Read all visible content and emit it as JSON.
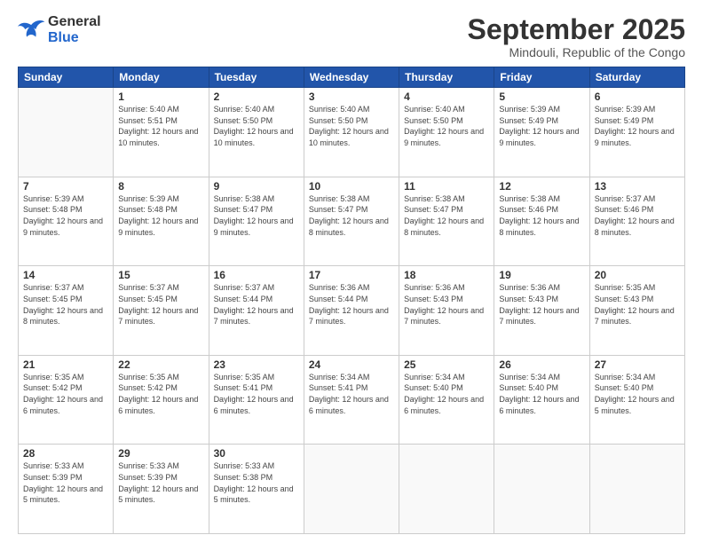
{
  "header": {
    "logo_general": "General",
    "logo_blue": "Blue",
    "month": "September 2025",
    "location": "Mindouli, Republic of the Congo"
  },
  "weekdays": [
    "Sunday",
    "Monday",
    "Tuesday",
    "Wednesday",
    "Thursday",
    "Friday",
    "Saturday"
  ],
  "weeks": [
    [
      {
        "day": "",
        "sunrise": "",
        "sunset": "",
        "daylight": ""
      },
      {
        "day": "1",
        "sunrise": "Sunrise: 5:40 AM",
        "sunset": "Sunset: 5:51 PM",
        "daylight": "Daylight: 12 hours and 10 minutes."
      },
      {
        "day": "2",
        "sunrise": "Sunrise: 5:40 AM",
        "sunset": "Sunset: 5:50 PM",
        "daylight": "Daylight: 12 hours and 10 minutes."
      },
      {
        "day": "3",
        "sunrise": "Sunrise: 5:40 AM",
        "sunset": "Sunset: 5:50 PM",
        "daylight": "Daylight: 12 hours and 10 minutes."
      },
      {
        "day": "4",
        "sunrise": "Sunrise: 5:40 AM",
        "sunset": "Sunset: 5:50 PM",
        "daylight": "Daylight: 12 hours and 9 minutes."
      },
      {
        "day": "5",
        "sunrise": "Sunrise: 5:39 AM",
        "sunset": "Sunset: 5:49 PM",
        "daylight": "Daylight: 12 hours and 9 minutes."
      },
      {
        "day": "6",
        "sunrise": "Sunrise: 5:39 AM",
        "sunset": "Sunset: 5:49 PM",
        "daylight": "Daylight: 12 hours and 9 minutes."
      }
    ],
    [
      {
        "day": "7",
        "sunrise": "Sunrise: 5:39 AM",
        "sunset": "Sunset: 5:48 PM",
        "daylight": "Daylight: 12 hours and 9 minutes."
      },
      {
        "day": "8",
        "sunrise": "Sunrise: 5:39 AM",
        "sunset": "Sunset: 5:48 PM",
        "daylight": "Daylight: 12 hours and 9 minutes."
      },
      {
        "day": "9",
        "sunrise": "Sunrise: 5:38 AM",
        "sunset": "Sunset: 5:47 PM",
        "daylight": "Daylight: 12 hours and 9 minutes."
      },
      {
        "day": "10",
        "sunrise": "Sunrise: 5:38 AM",
        "sunset": "Sunset: 5:47 PM",
        "daylight": "Daylight: 12 hours and 8 minutes."
      },
      {
        "day": "11",
        "sunrise": "Sunrise: 5:38 AM",
        "sunset": "Sunset: 5:47 PM",
        "daylight": "Daylight: 12 hours and 8 minutes."
      },
      {
        "day": "12",
        "sunrise": "Sunrise: 5:38 AM",
        "sunset": "Sunset: 5:46 PM",
        "daylight": "Daylight: 12 hours and 8 minutes."
      },
      {
        "day": "13",
        "sunrise": "Sunrise: 5:37 AM",
        "sunset": "Sunset: 5:46 PM",
        "daylight": "Daylight: 12 hours and 8 minutes."
      }
    ],
    [
      {
        "day": "14",
        "sunrise": "Sunrise: 5:37 AM",
        "sunset": "Sunset: 5:45 PM",
        "daylight": "Daylight: 12 hours and 8 minutes."
      },
      {
        "day": "15",
        "sunrise": "Sunrise: 5:37 AM",
        "sunset": "Sunset: 5:45 PM",
        "daylight": "Daylight: 12 hours and 7 minutes."
      },
      {
        "day": "16",
        "sunrise": "Sunrise: 5:37 AM",
        "sunset": "Sunset: 5:44 PM",
        "daylight": "Daylight: 12 hours and 7 minutes."
      },
      {
        "day": "17",
        "sunrise": "Sunrise: 5:36 AM",
        "sunset": "Sunset: 5:44 PM",
        "daylight": "Daylight: 12 hours and 7 minutes."
      },
      {
        "day": "18",
        "sunrise": "Sunrise: 5:36 AM",
        "sunset": "Sunset: 5:43 PM",
        "daylight": "Daylight: 12 hours and 7 minutes."
      },
      {
        "day": "19",
        "sunrise": "Sunrise: 5:36 AM",
        "sunset": "Sunset: 5:43 PM",
        "daylight": "Daylight: 12 hours and 7 minutes."
      },
      {
        "day": "20",
        "sunrise": "Sunrise: 5:35 AM",
        "sunset": "Sunset: 5:43 PM",
        "daylight": "Daylight: 12 hours and 7 minutes."
      }
    ],
    [
      {
        "day": "21",
        "sunrise": "Sunrise: 5:35 AM",
        "sunset": "Sunset: 5:42 PM",
        "daylight": "Daylight: 12 hours and 6 minutes."
      },
      {
        "day": "22",
        "sunrise": "Sunrise: 5:35 AM",
        "sunset": "Sunset: 5:42 PM",
        "daylight": "Daylight: 12 hours and 6 minutes."
      },
      {
        "day": "23",
        "sunrise": "Sunrise: 5:35 AM",
        "sunset": "Sunset: 5:41 PM",
        "daylight": "Daylight: 12 hours and 6 minutes."
      },
      {
        "day": "24",
        "sunrise": "Sunrise: 5:34 AM",
        "sunset": "Sunset: 5:41 PM",
        "daylight": "Daylight: 12 hours and 6 minutes."
      },
      {
        "day": "25",
        "sunrise": "Sunrise: 5:34 AM",
        "sunset": "Sunset: 5:40 PM",
        "daylight": "Daylight: 12 hours and 6 minutes."
      },
      {
        "day": "26",
        "sunrise": "Sunrise: 5:34 AM",
        "sunset": "Sunset: 5:40 PM",
        "daylight": "Daylight: 12 hours and 6 minutes."
      },
      {
        "day": "27",
        "sunrise": "Sunrise: 5:34 AM",
        "sunset": "Sunset: 5:40 PM",
        "daylight": "Daylight: 12 hours and 5 minutes."
      }
    ],
    [
      {
        "day": "28",
        "sunrise": "Sunrise: 5:33 AM",
        "sunset": "Sunset: 5:39 PM",
        "daylight": "Daylight: 12 hours and 5 minutes."
      },
      {
        "day": "29",
        "sunrise": "Sunrise: 5:33 AM",
        "sunset": "Sunset: 5:39 PM",
        "daylight": "Daylight: 12 hours and 5 minutes."
      },
      {
        "day": "30",
        "sunrise": "Sunrise: 5:33 AM",
        "sunset": "Sunset: 5:38 PM",
        "daylight": "Daylight: 12 hours and 5 minutes."
      },
      {
        "day": "",
        "sunrise": "",
        "sunset": "",
        "daylight": ""
      },
      {
        "day": "",
        "sunrise": "",
        "sunset": "",
        "daylight": ""
      },
      {
        "day": "",
        "sunrise": "",
        "sunset": "",
        "daylight": ""
      },
      {
        "day": "",
        "sunrise": "",
        "sunset": "",
        "daylight": ""
      }
    ]
  ]
}
